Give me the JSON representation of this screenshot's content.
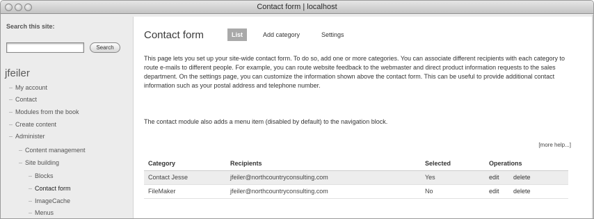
{
  "window": {
    "title": "Contact form | localhost"
  },
  "sidebar": {
    "search_label": "Search this site:",
    "search_value": "",
    "search_button": "Search",
    "user_name": "jfeiler",
    "items": [
      {
        "label": "My account"
      },
      {
        "label": "Contact"
      },
      {
        "label": "Modules from the book"
      },
      {
        "label": "Create content"
      },
      {
        "label": "Administer"
      },
      {
        "label": "Content management"
      },
      {
        "label": "Site building"
      },
      {
        "label": "Blocks"
      },
      {
        "label": "Contact form"
      },
      {
        "label": "ImageCache"
      },
      {
        "label": "Menus"
      }
    ]
  },
  "main": {
    "title": "Contact form",
    "tabs": [
      {
        "label": "List"
      },
      {
        "label": "Add category"
      },
      {
        "label": "Settings"
      }
    ],
    "description_1": "This page lets you set up your site-wide contact form. To do so, add one or more categories. You can associate different recipients with each category to route e-mails to different people. For example, you can route website feedback to the webmaster and direct product information requests to the sales department. On the settings page, you can customize the information shown above the contact form. This can be useful to provide additional contact information such as your postal address and telephone number.",
    "description_2": "The contact module also adds a menu item (disabled by default) to the navigation block.",
    "more_help": "[more help...]",
    "table": {
      "headers": [
        "Category",
        "Recipients",
        "Selected",
        "Operations"
      ],
      "rows": [
        {
          "category": "Contact Jesse",
          "recipients": "jfeiler@northcountryconsulting.com",
          "selected": "Yes",
          "edit": "edit",
          "delete": "delete"
        },
        {
          "category": "FileMaker",
          "recipients": "jfeiler@northcountryconsulting.com",
          "selected": "No",
          "edit": "edit",
          "delete": "delete"
        }
      ]
    }
  }
}
